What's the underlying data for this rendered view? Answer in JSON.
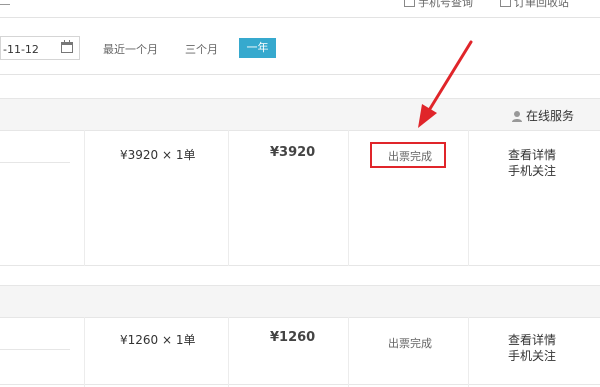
{
  "topbar": {
    "links": [
      {
        "label": "手机号查询"
      },
      {
        "label": "订单回收站"
      }
    ]
  },
  "filter": {
    "date_end": "-11-12",
    "ranges": [
      "最近一个月",
      "三个月"
    ],
    "active_range": "一年"
  },
  "orders": [
    {
      "header_service": "在线服务",
      "price": "¥3920 × 1单",
      "total": "¥3920",
      "status": "出票完成",
      "actions": [
        "查看详情",
        "手机关注"
      ]
    },
    {
      "price": "¥1260 × 1单",
      "total": "¥1260",
      "status": "出票完成",
      "actions": [
        "查看详情",
        "手机关注"
      ]
    }
  ],
  "annotation": {
    "arrow_color": "#e0252a"
  }
}
